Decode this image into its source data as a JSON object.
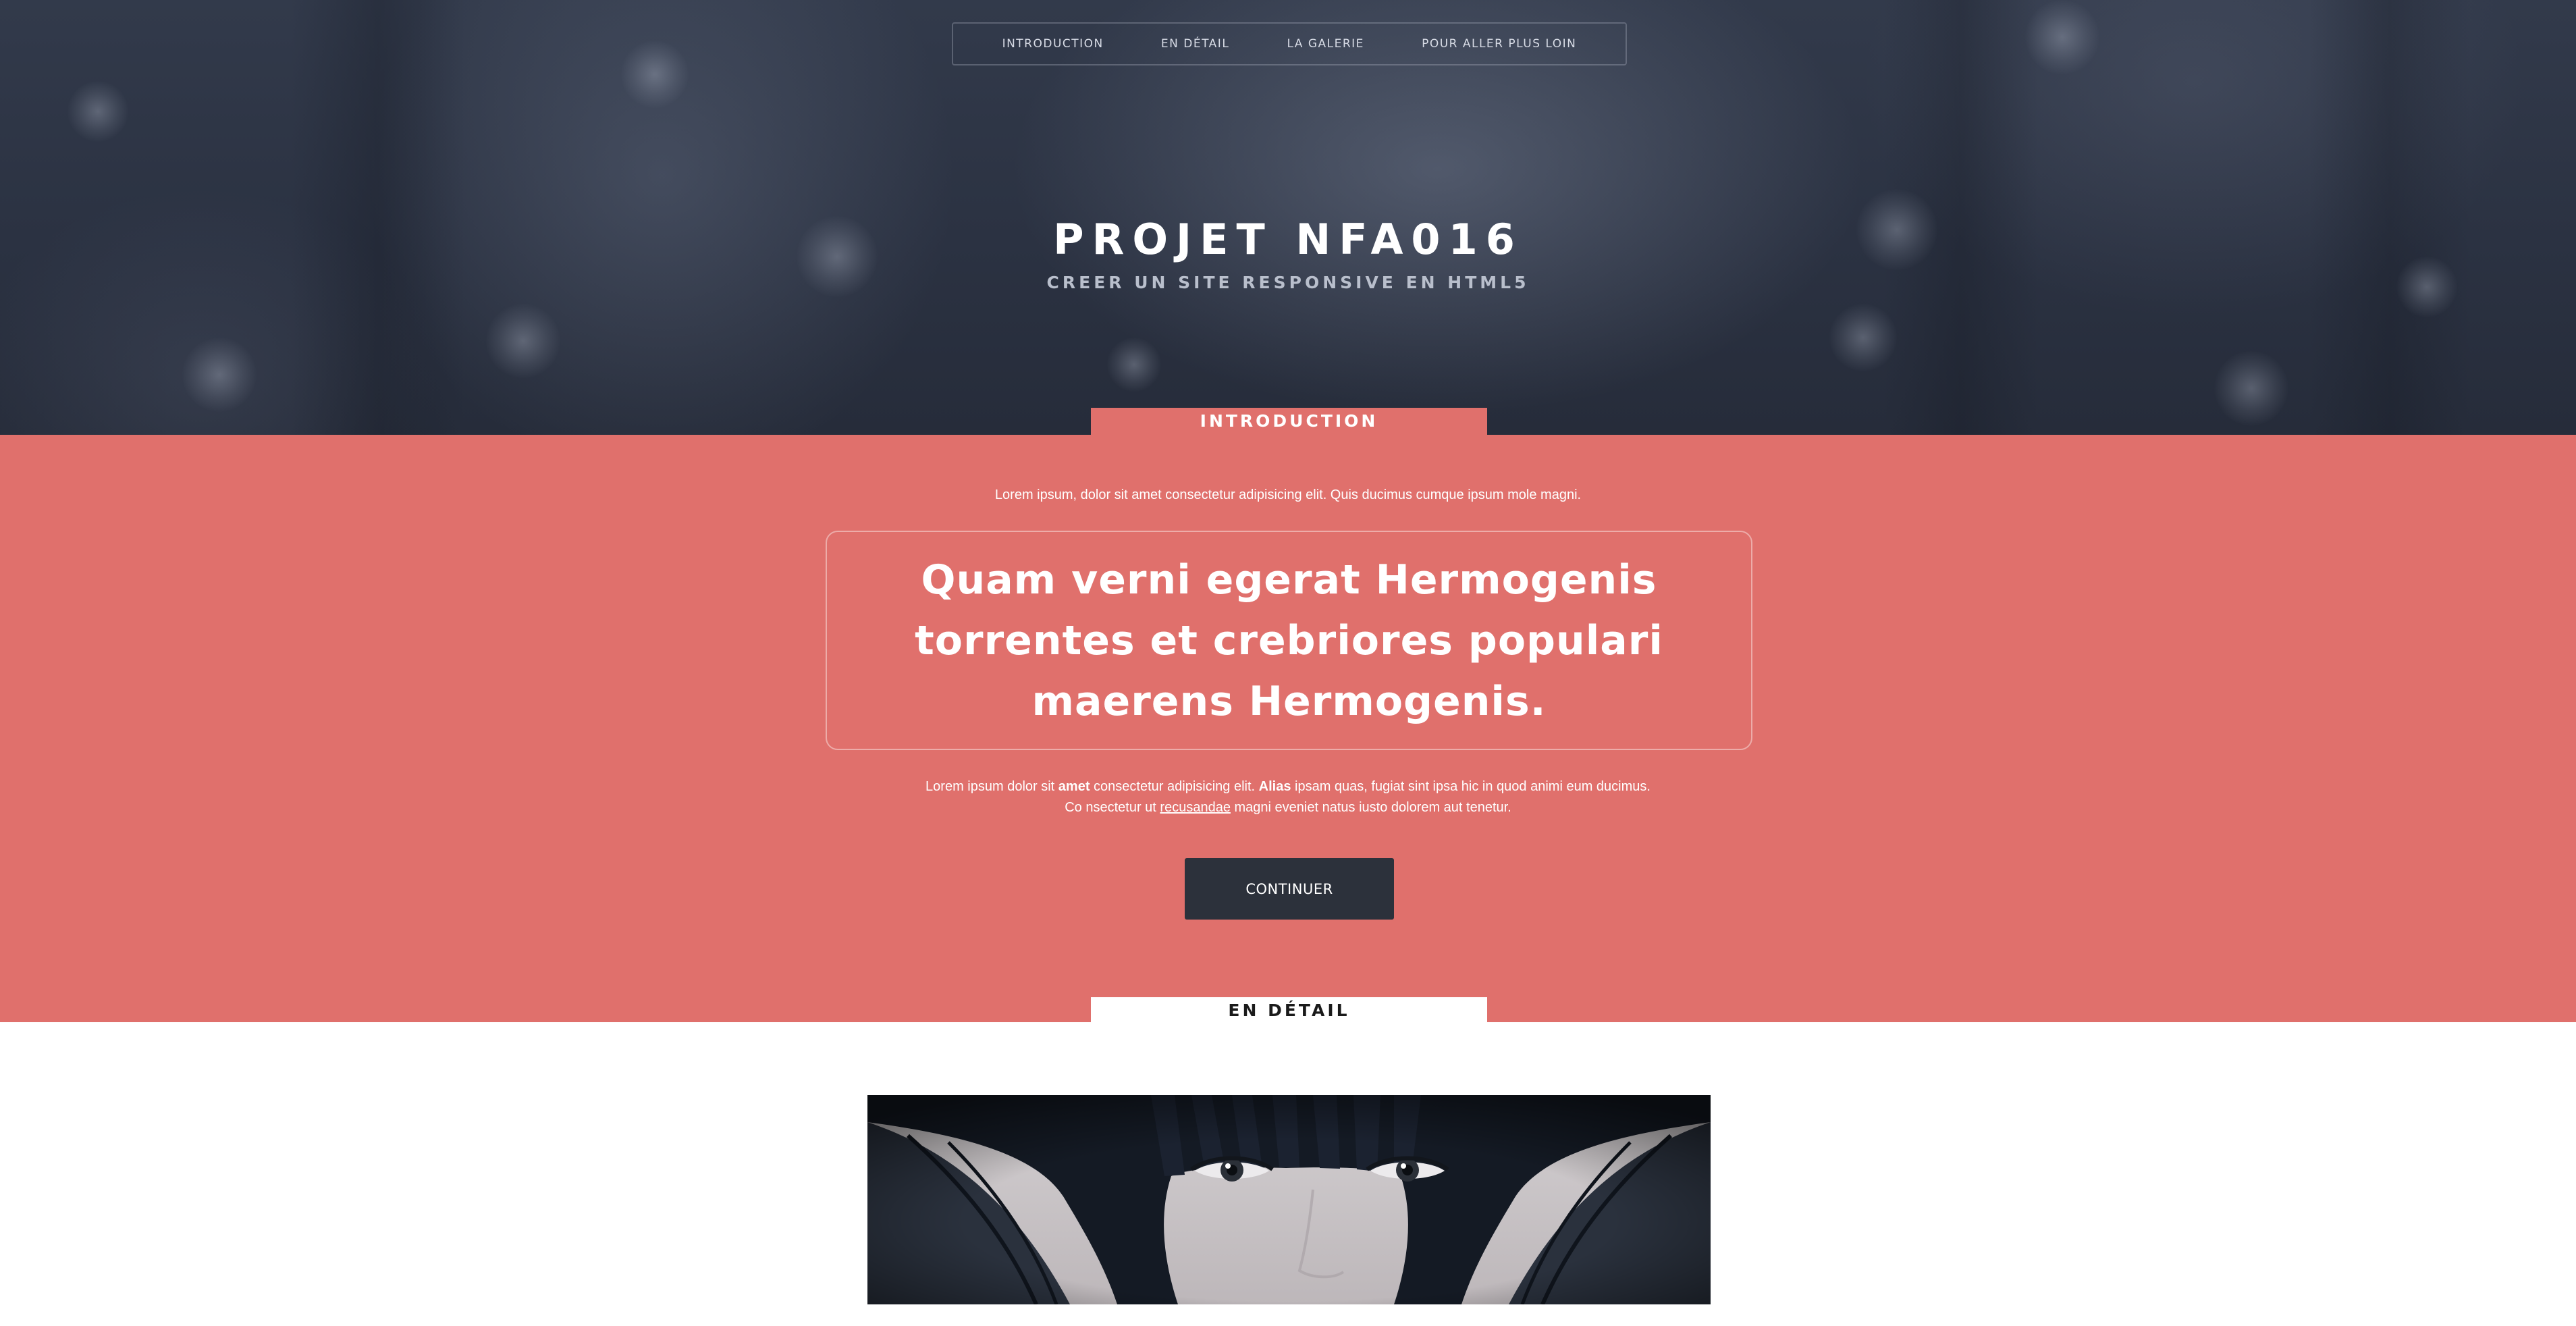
{
  "nav": {
    "items": [
      {
        "label": "INTRODUCTION"
      },
      {
        "label": "EN DÉTAIL"
      },
      {
        "label": "LA GALERIE"
      },
      {
        "label": "POUR ALLER PLUS LOIN"
      }
    ]
  },
  "hero": {
    "title": "PROJET NFA016",
    "subtitle": "CREER UN SITE RESPONSIVE EN HTML5"
  },
  "intro": {
    "tab_label": "INTRODUCTION",
    "lead": "Lorem ipsum, dolor sit amet consectetur adipisicing elit. Quis ducimus cumque ipsum mole magni.",
    "quote": "Quam verni egerat Hermogenis torrentes et crebriores populari maerens Hermogenis.",
    "body": {
      "part1": "Lorem ipsum dolor sit ",
      "bold1": "amet",
      "part2": " consectetur adipisicing elit. ",
      "bold2": "Alias",
      "part3": " ipsam quas, fugiat sint ipsa hic in quod animi eum ducimus.",
      "line2_part1": "Co nsectetur ut ",
      "line2_link": "recusandae",
      "line2_part2": " magni eveniet natus iusto dolorem aut tenetur."
    },
    "button_label": "CONTINUER"
  },
  "detail": {
    "tab_label": "EN DÉTAIL"
  },
  "colors": {
    "hero_bg": "#2b3242",
    "intro_bg": "#e0706c",
    "button_bg": "#2c313b",
    "white": "#ffffff"
  }
}
